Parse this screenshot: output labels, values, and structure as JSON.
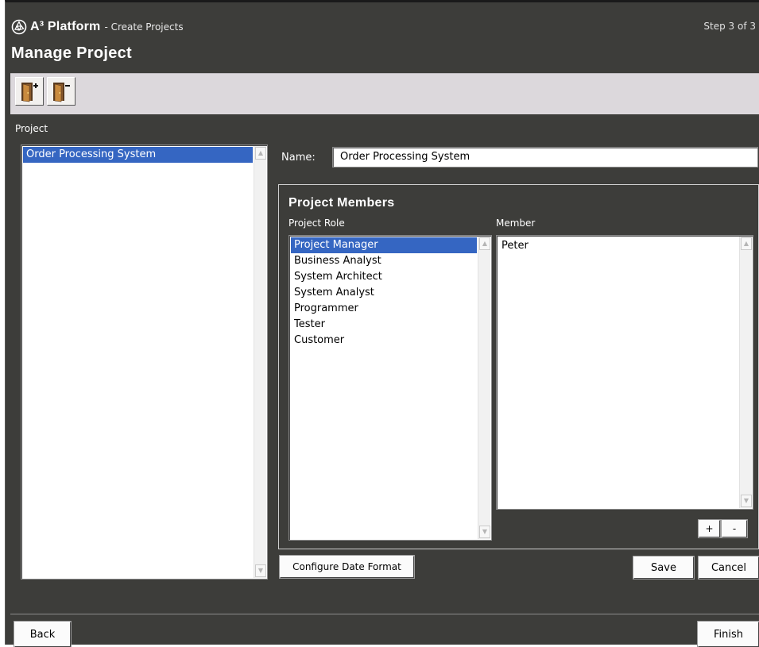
{
  "header": {
    "app_name": "A³ Platform",
    "subtitle": "- Create Projects",
    "step": "Step 3 of 3",
    "page_title": "Manage Project"
  },
  "toolbar": {
    "buttons": [
      {
        "name": "add-project-button",
        "icon": "door-add-icon"
      },
      {
        "name": "remove-project-button",
        "icon": "door-remove-icon"
      }
    ]
  },
  "project": {
    "label": "Project",
    "items": [
      "Order Processing System"
    ],
    "selected_index": 0
  },
  "name_field": {
    "label": "Name:",
    "value": "Order Processing System"
  },
  "members": {
    "title": "Project Members",
    "role_label": "Project Role",
    "member_label": "Member",
    "roles": [
      "Project Manager",
      "Business Analyst",
      "System Architect",
      "System Analyst",
      "Programmer",
      "Tester",
      "Customer"
    ],
    "selected_role_index": 0,
    "member_items": [
      "Peter"
    ],
    "add_label": "+",
    "remove_label": "-"
  },
  "actions": {
    "configure_date_format": "Configure Date Format",
    "save": "Save",
    "cancel": "Cancel"
  },
  "footer": {
    "back": "Back",
    "finish": "Finish"
  },
  "colors": {
    "window_bg": "#3d3d3a",
    "toolbar_bg": "#dcd8dc",
    "selection": "#3566c2"
  }
}
